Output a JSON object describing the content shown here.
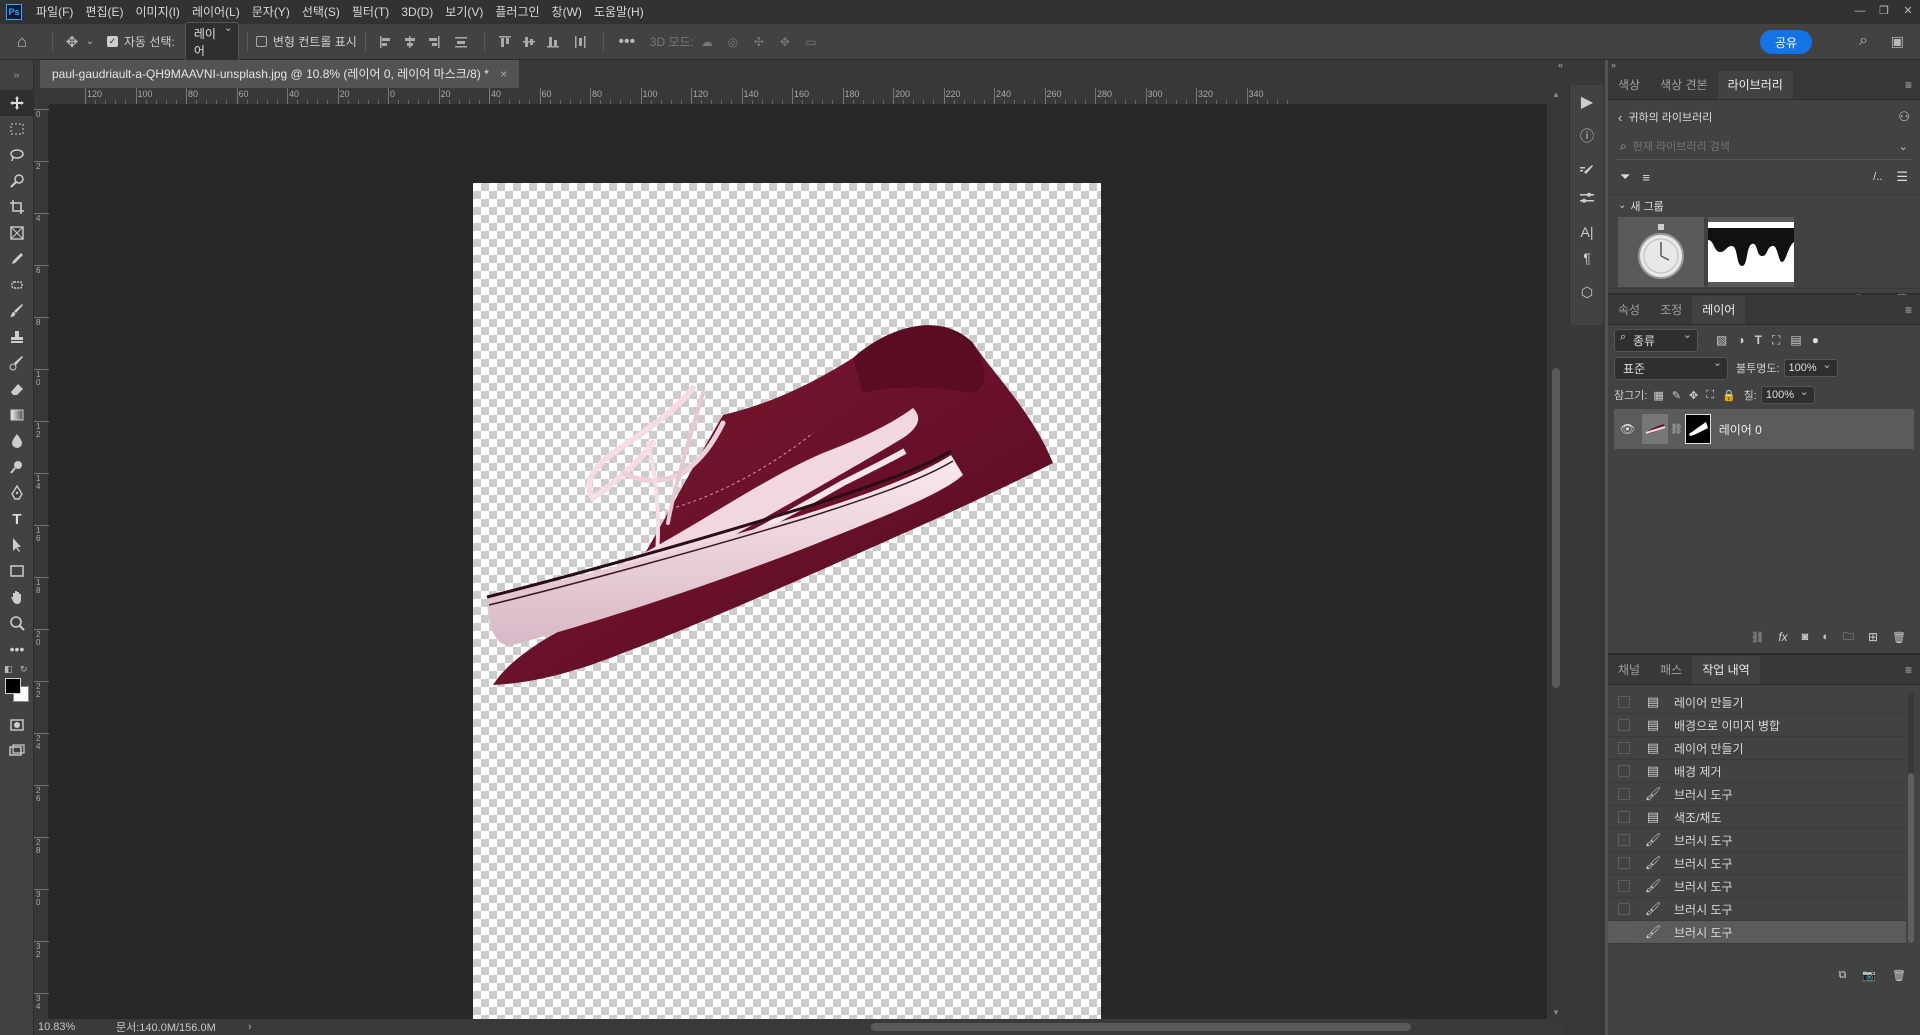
{
  "app": {
    "logo": "Ps"
  },
  "menu": [
    "파일(F)",
    "편집(E)",
    "이미지(I)",
    "레이어(L)",
    "문자(Y)",
    "선택(S)",
    "필터(T)",
    "3D(D)",
    "보기(V)",
    "플러그인",
    "창(W)",
    "도움말(H)"
  ],
  "options_bar": {
    "auto_select_label": "자동 선택:",
    "auto_select_value": "레이어",
    "transform_controls_label": "변형 컨트롤 표시",
    "mode_3d_label": "3D 모드:",
    "share_label": "공유"
  },
  "document": {
    "tab_title": "paul-gaudriault-a-QH9MAAVNI-unsplash.jpg @ 10.8% (레이어 0, 레이어 마스크/8) *",
    "close": "×"
  },
  "ruler": {
    "h_labels": [
      "120",
      "100",
      "80",
      "60",
      "40",
      "20",
      "0",
      "20",
      "40",
      "60",
      "80",
      "100",
      "120",
      "140",
      "160",
      "180",
      "200",
      "220",
      "240",
      "260",
      "280",
      "300",
      "320",
      "340"
    ],
    "v_labels": [
      "0",
      "2",
      "4",
      "6",
      "8",
      "10",
      "12",
      "14",
      "16",
      "18",
      "20",
      "22",
      "24",
      "26",
      "28",
      "30",
      "32",
      "34"
    ]
  },
  "status": {
    "zoom": "10.83%",
    "doc": "문서:140.0M/156.0M",
    "arrow": "›"
  },
  "libraries_panel": {
    "tabs": [
      "색상",
      "색상 견본",
      "라이브러리"
    ],
    "active_tab": "라이브러리",
    "back_label": "귀하의 라이브러리",
    "search_placeholder": "현재 라이브러리 검색",
    "group_label": "새 그룹"
  },
  "layers_panel": {
    "tabs": [
      "속성",
      "조정",
      "레이어"
    ],
    "active_tab": "레이어",
    "filter_kind": "종류",
    "blend_mode": "표준",
    "opacity_label": "불투명도:",
    "opacity_value": "100%",
    "lock_label": "잠그기:",
    "fill_label": "칠:",
    "fill_value": "100%",
    "layers": [
      {
        "name": "레이어 0",
        "visible": true
      }
    ]
  },
  "history_panel": {
    "tabs": [
      "채널",
      "패스",
      "작업 내역"
    ],
    "active_tab": "작업 내역",
    "items": [
      {
        "label": "레이어 만들기",
        "icon": "doc"
      },
      {
        "label": "배경으로 이미지 병합",
        "icon": "doc"
      },
      {
        "label": "레이어 만들기",
        "icon": "doc"
      },
      {
        "label": "배경 제거",
        "icon": "doc"
      },
      {
        "label": "브러시 도구",
        "icon": "brush"
      },
      {
        "label": "색조/채도",
        "icon": "doc"
      },
      {
        "label": "브러시 도구",
        "icon": "brush"
      },
      {
        "label": "브러시 도구",
        "icon": "brush"
      },
      {
        "label": "브러시 도구",
        "icon": "brush"
      },
      {
        "label": "브러시 도구",
        "icon": "brush"
      },
      {
        "label": "브러시 도구",
        "icon": "brush"
      }
    ],
    "selected_index": 10
  },
  "colors": {
    "accent": "#1473e6",
    "shoe_upper": "#6b0f24",
    "shoe_sole": "#f3dde6"
  }
}
